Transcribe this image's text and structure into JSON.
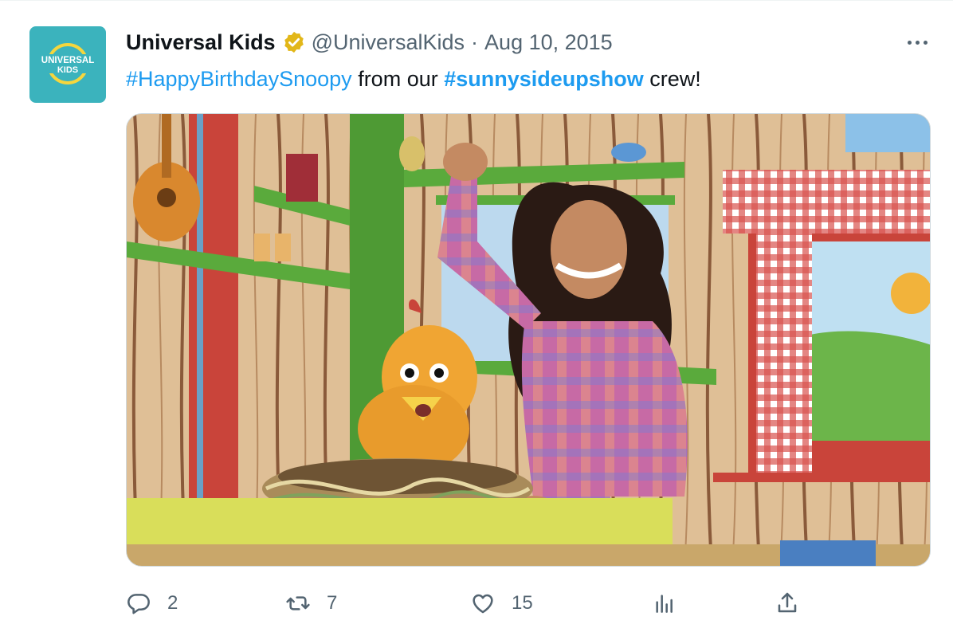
{
  "author": {
    "name": "Universal Kids",
    "handle": "@UniversalKids",
    "separator": "·",
    "date": "Aug 10, 2015",
    "avatar_text": [
      "UNIVERSAL",
      "KIDS"
    ],
    "verified_color": "#e2b719"
  },
  "tweet": {
    "hashtag_1": "#HappyBirthdaySnoopy",
    "text_1": " from our ",
    "hashtag_2": "#sunnysideupshow",
    "text_2": " crew!"
  },
  "media": {
    "alt": "Host waving next to a chicken puppet on a treehouse set"
  },
  "actions": {
    "replies": "2",
    "retweets": "7",
    "likes": "15"
  },
  "icons": [
    "more-icon",
    "reply-icon",
    "retweet-icon",
    "like-icon",
    "views-icon",
    "share-icon",
    "verified-icon"
  ],
  "colors": {
    "accent": "#1d9bf0",
    "secondary_text": "#536471",
    "avatar_bg": "#3bb3bd"
  }
}
